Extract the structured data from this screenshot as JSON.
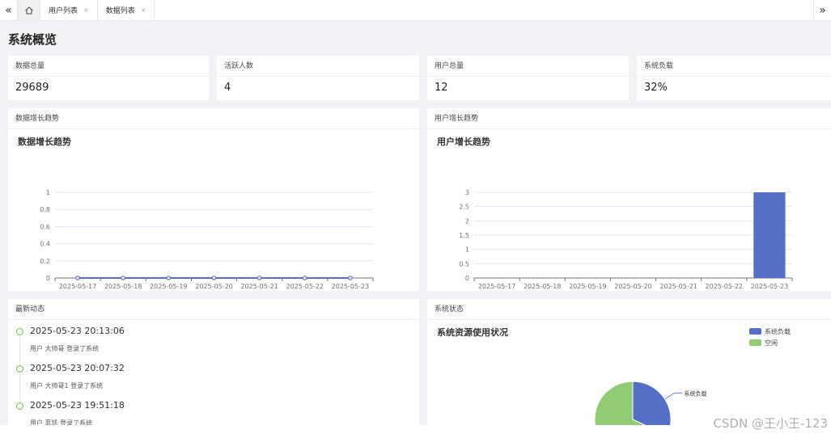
{
  "tabs": {
    "collapse_icon": "«",
    "expand_icon": "»",
    "home_icon": "home-icon",
    "items": [
      {
        "label": "用户列表",
        "close": "×"
      },
      {
        "label": "数据列表",
        "close": "×"
      }
    ]
  },
  "page": {
    "title": "系统概览"
  },
  "stats": [
    {
      "label": "数据总量",
      "value": "29689"
    },
    {
      "label": "活跃人数",
      "value": "4"
    },
    {
      "label": "用户总量",
      "value": "12"
    },
    {
      "label": "系统负载",
      "value": "32%"
    }
  ],
  "cards": {
    "data_trend_header": "数据增长趋势",
    "user_trend_header": "用户增长趋势",
    "activity_header": "最新动态",
    "status_header": "系统状态"
  },
  "activity": [
    {
      "time": "2025-05-23 20:13:06",
      "text": "用户 大帅哥 登录了系统"
    },
    {
      "time": "2025-05-23 20:07:32",
      "text": "用户 大帅哥1 登录了系统"
    },
    {
      "time": "2025-05-23 19:51:18",
      "text": "用户 菲凯 登录了系统"
    }
  ],
  "colors": {
    "blue": "#5470c6",
    "green": "#91cc75",
    "accent": "#67c23a"
  },
  "chart_data": [
    {
      "type": "line",
      "title": "数据增长趋势",
      "categories": [
        "2025-05-17",
        "2025-05-18",
        "2025-05-19",
        "2025-05-20",
        "2025-05-21",
        "2025-05-22",
        "2025-05-23"
      ],
      "values": [
        0,
        0,
        0,
        0,
        0,
        0,
        0
      ],
      "ylim": [
        0,
        1
      ],
      "yticks": [
        "0",
        "0.2",
        "0.4",
        "0.6",
        "0.8",
        "1"
      ],
      "grid": true
    },
    {
      "type": "bar",
      "title": "用户增长趋势",
      "categories": [
        "2025-05-17",
        "2025-05-18",
        "2025-05-19",
        "2025-05-20",
        "2025-05-21",
        "2025-05-22",
        "2025-05-23"
      ],
      "values": [
        0,
        0,
        0,
        0,
        0,
        0,
        3
      ],
      "ylim": [
        0,
        3
      ],
      "yticks": [
        "0",
        "0.5",
        "1",
        "1.5",
        "2",
        "2.5",
        "3"
      ],
      "grid": true
    },
    {
      "type": "pie",
      "title": "系统资源使用状况",
      "slices": [
        {
          "name": "系统负载",
          "value": 32
        },
        {
          "name": "空闲",
          "value": 68
        }
      ],
      "legend": "top-right"
    }
  ],
  "watermark": "CSDN @王小王-123"
}
